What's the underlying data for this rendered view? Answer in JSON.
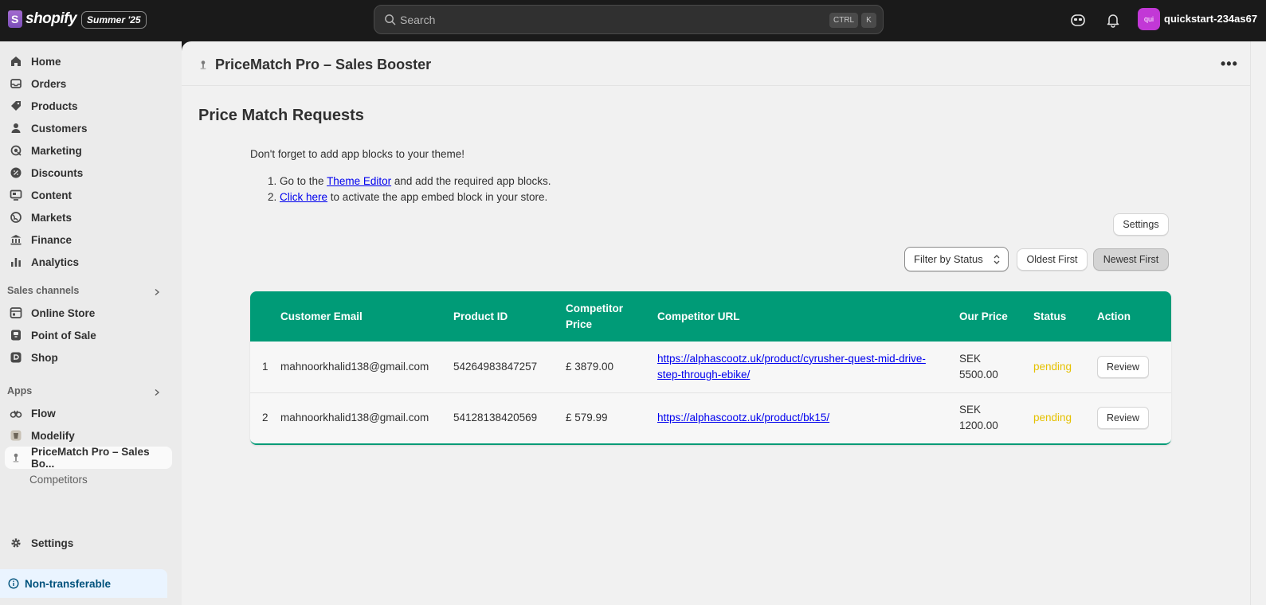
{
  "topbar": {
    "brand": "shopify",
    "edition": "Summer '25",
    "search_placeholder": "Search",
    "shortcut_ctrl": "CTRL",
    "shortcut_k": "K",
    "avatar_initials": "qui",
    "store_name": "quickstart-234as67"
  },
  "sidebar": {
    "items": [
      {
        "label": "Home",
        "icon": "home-icon"
      },
      {
        "label": "Orders",
        "icon": "orders-icon"
      },
      {
        "label": "Products",
        "icon": "products-icon"
      },
      {
        "label": "Customers",
        "icon": "customers-icon"
      },
      {
        "label": "Marketing",
        "icon": "marketing-icon"
      },
      {
        "label": "Discounts",
        "icon": "discounts-icon"
      },
      {
        "label": "Content",
        "icon": "content-icon"
      },
      {
        "label": "Markets",
        "icon": "markets-icon"
      },
      {
        "label": "Finance",
        "icon": "finance-icon"
      },
      {
        "label": "Analytics",
        "icon": "analytics-icon"
      }
    ],
    "sales_channels_label": "Sales channels",
    "sales_channels": [
      {
        "label": "Online Store",
        "icon": "online-store-icon"
      },
      {
        "label": "Point of Sale",
        "icon": "point-of-sale-icon"
      },
      {
        "label": "Shop",
        "icon": "shop-icon"
      }
    ],
    "apps_label": "Apps",
    "apps": [
      {
        "label": "Flow",
        "icon": "flow-icon"
      },
      {
        "label": "Modelify",
        "icon": "modelify-icon"
      },
      {
        "label": "PriceMatch Pro – Sales Bo...",
        "icon": "pricematch-icon"
      }
    ],
    "app_subitem": "Competitors",
    "settings_label": "Settings",
    "non_transferable": "Non-transferable"
  },
  "main": {
    "app_title": "PriceMatch Pro – Sales Booster",
    "more_label": "•••",
    "page_title": "Price Match Requests",
    "notice": "Don't forget to add app blocks to your theme!",
    "step1": {
      "pre": "Go to the ",
      "link": "Theme Editor",
      "post": " and add the required app blocks."
    },
    "step2": {
      "link": "Click here",
      "post": " to activate the app embed block in your store."
    },
    "settings_button": "Settings",
    "filter_label": "Filter by Status",
    "oldest_button": "Oldest First",
    "newest_button": "Newest First"
  },
  "table": {
    "headers": [
      "",
      "Customer Email",
      "Product ID",
      "Competitor Price",
      "Competitor URL",
      "Our Price",
      "Status",
      "Action"
    ],
    "rows": [
      {
        "num": "1",
        "email": "mahnoorkhalid138@gmail.com",
        "product_id": "54264983847257",
        "competitor_price": "£ 3879.00",
        "url": "https://alphascootz.uk/product/cyrusher-quest-mid-drive-step-through-ebike/",
        "our_price": "SEK 5500.00",
        "status": "pending",
        "action": "Review"
      },
      {
        "num": "2",
        "email": "mahnoorkhalid138@gmail.com",
        "product_id": "54128138420569",
        "competitor_price": "£ 579.99",
        "url": "https://alphascootz.uk/product/bk15/",
        "our_price": "SEK 1200.00",
        "status": "pending",
        "action": "Review"
      }
    ]
  },
  "colors": {
    "header_green": "#009b77",
    "pending": "#e5c100",
    "avatar": "#c238d6"
  }
}
